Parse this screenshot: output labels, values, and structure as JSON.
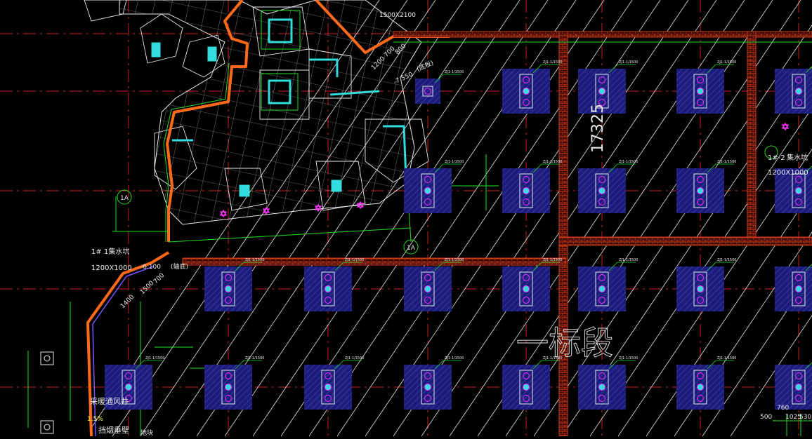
{
  "colors": {
    "background": "#000000",
    "axis_red": "#cc2222",
    "wall_brick": "#d03a1a",
    "wall_orange": "#ff6a1a",
    "pile_fill": "#1c1c7a",
    "pile_hatch": "#5555cc",
    "dim_green": "#22dd22",
    "white_lines": "#e8e8e8",
    "magenta": "#ff33ff",
    "cyan": "#33dddd",
    "yellow": "#ffff55"
  },
  "labels": {
    "dim_17325": "17325",
    "section_text": "一标段",
    "sump_left": "1集水坑",
    "sump_left_id": "1#",
    "sump_left_size": "1200X1000",
    "sump_right": "集水坑",
    "sump_right_id": "1#-2",
    "sump_right_size": "1200X1000",
    "top_size": "1500X2100",
    "elev_left": "-6.100",
    "elev_left_note": "(轴底)",
    "elev_mid": "-7.550",
    "elev_mid_note": "(底板)",
    "axis_1a_left": "1A",
    "axis_1a_mid": "1A",
    "dim_1200_700": "1200 700",
    "dim_800": "800",
    "dim_1400": "1400",
    "dim_1500": "1500",
    "dim_700": "700",
    "dim_500": "500",
    "dim_760": "760",
    "dim_1025": "1025",
    "dim_530": "530",
    "bottom_left_note_1": "采暖通风井",
    "bottom_left_note_2": "挡烟垂壁",
    "slope_note": "1.5%",
    "misc_note": "地块",
    "pile_tag": "ZJ1-1/1500"
  }
}
